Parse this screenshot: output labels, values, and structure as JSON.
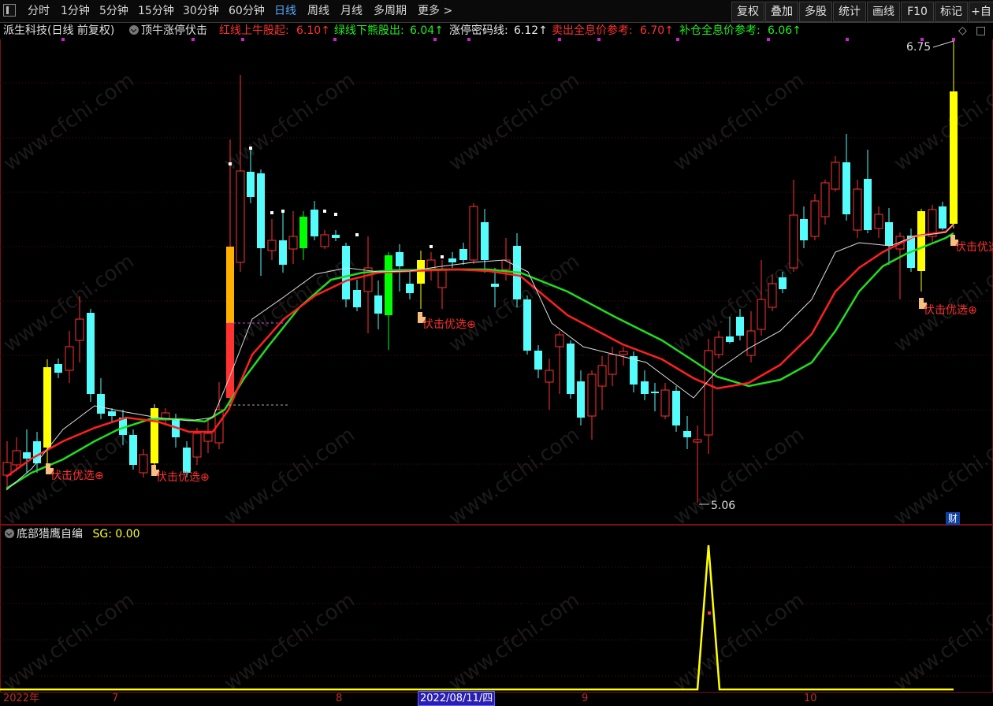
{
  "toolbar": {
    "periods": [
      "分时",
      "1分钟",
      "5分钟",
      "15分钟",
      "30分钟",
      "60分钟",
      "日线",
      "周线",
      "月线",
      "多周期",
      "更多 >"
    ],
    "active_period": "日线",
    "right_buttons": [
      "复权",
      "叠加",
      "多股",
      "统计",
      "画线",
      "F10",
      "标记",
      "+自"
    ]
  },
  "info": {
    "stock": "派生科技(日线 前复权)",
    "indicator": "顶牛涨停伏击",
    "red_line_label": "红线上牛股起:",
    "red_line_value": "6.10↑",
    "green_line_label": "绿线下熊股出:",
    "green_line_value": "6.04↑",
    "limit_label": "涨停密码线:",
    "limit_value": "6.12↑",
    "sell_label": "卖出全息价参考:",
    "sell_value": "6.70↑",
    "add_label": "补仓全息价参考:",
    "add_value": "6.06↑"
  },
  "chart": {
    "high_label": "6.75",
    "low_label": "5.06",
    "signal_label": "伏击优选⊕",
    "watermark": "www.cfchi.com",
    "cai": "财"
  },
  "sub": {
    "title": "底部猎鹰自编",
    "sg_label": "SG: 0.00"
  },
  "dates": {
    "year": "2022年",
    "m7": "7",
    "m8": "8",
    "selected": "2022/08/11/四",
    "m9": "9",
    "m10": "10"
  },
  "colors": {
    "up": "#ff3232",
    "down": "#54fcfc",
    "yellow": "#ffff00",
    "green": "#00ff00",
    "red_line": "#ff2020",
    "green_line": "#20dd20",
    "white_line": "#dddddd"
  }
}
